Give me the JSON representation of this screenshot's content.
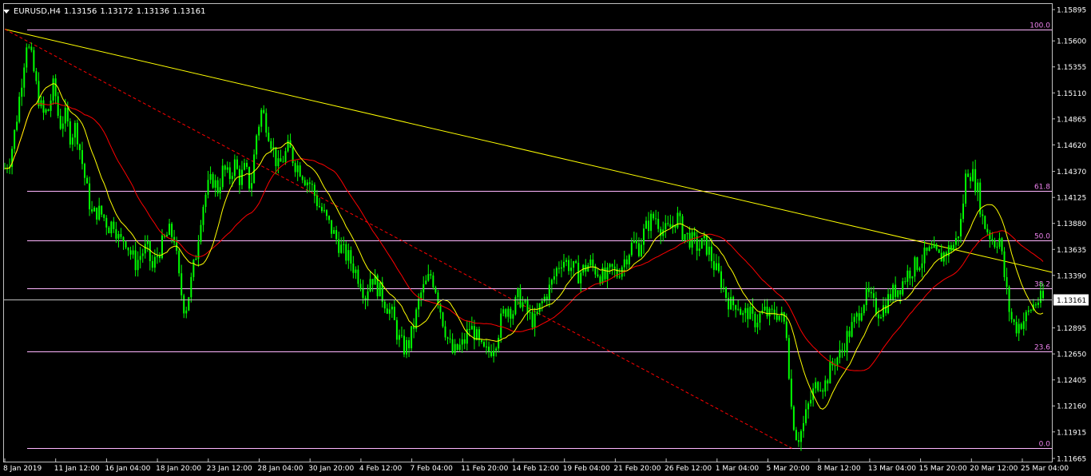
{
  "header": {
    "symbol": "EURUSD,H4",
    "open": "1.13156",
    "high": "1.13172",
    "low": "1.13136",
    "close": "1.13161"
  },
  "colors": {
    "background": "#000000",
    "candle": "#00ff00",
    "price_line": "#c0c0c0",
    "ma_fast": "#ffff00",
    "ma_slow": "#ff0000",
    "trendline": "#ffff00",
    "diagonal": "#ff0000",
    "fib": "#ffb6ff",
    "fib_label": "#ee82ee"
  },
  "chart_data": {
    "type": "candlestick",
    "ylim": [
      1.11665,
      1.15895
    ],
    "y_ticks": [
      "1.15895",
      "1.15600",
      "1.15355",
      "1.15110",
      "1.14865",
      "1.14620",
      "1.14370",
      "1.14125",
      "1.13880",
      "1.13635",
      "1.13390",
      "1.12895",
      "1.12650",
      "1.12405",
      "1.12160",
      "1.11915",
      "1.11665"
    ],
    "x_ticks": [
      "8 Jan 2019",
      "11 Jan 12:00",
      "16 Jan 04:00",
      "18 Jan 20:00",
      "23 Jan 12:00",
      "28 Jan 04:00",
      "30 Jan 20:00",
      "4 Feb 12:00",
      "7 Feb 04:00",
      "11 Feb 20:00",
      "14 Feb 12:00",
      "19 Feb 04:00",
      "21 Feb 20:00",
      "26 Feb 12:00",
      "1 Mar 04:00",
      "5 Mar 20:00",
      "8 Mar 12:00",
      "13 Mar 04:00",
      "15 Mar 20:00",
      "20 Mar 12:00",
      "25 Mar 04:00"
    ],
    "current_price": "1.13161",
    "fib_levels": [
      {
        "label": "100.0",
        "price": 1.1571
      },
      {
        "label": "61.8",
        "price": 1.1419
      },
      {
        "label": "50.0",
        "price": 1.1372
      },
      {
        "label": "38.2",
        "price": 1.1327
      },
      {
        "label": "23.6",
        "price": 1.1267
      },
      {
        "label": "0.0",
        "price": 1.1176
      }
    ],
    "trendline": {
      "from": {
        "x": "8 Jan 2019",
        "price": 1.1571
      },
      "to": {
        "x": "25 Mar 04:00",
        "price": 1.1342
      }
    },
    "diagonal": {
      "from": {
        "x": "8 Jan 2019",
        "price": 1.1571
      },
      "to": {
        "x": "5 Mar 20:00",
        "price": 1.1176
      }
    },
    "close_path": [
      [
        0,
        1.144
      ],
      [
        0.5,
        1.145
      ],
      [
        1,
        1.148
      ],
      [
        1.5,
        1.152
      ],
      [
        2,
        1.156
      ],
      [
        2.5,
        1.154
      ],
      [
        3,
        1.151
      ],
      [
        3.5,
        1.149
      ],
      [
        4,
        1.1495
      ],
      [
        4.5,
        1.152
      ],
      [
        5,
        1.148
      ],
      [
        5.5,
        1.149
      ],
      [
        6,
        1.147
      ],
      [
        6.5,
        1.148
      ],
      [
        7,
        1.145
      ],
      [
        7.5,
        1.142
      ],
      [
        8,
        1.1395
      ],
      [
        8.5,
        1.14
      ],
      [
        9,
        1.1395
      ],
      [
        9.5,
        1.1385
      ],
      [
        10,
        1.139
      ],
      [
        10.5,
        1.137
      ],
      [
        11,
        1.1375
      ],
      [
        11.5,
        1.136
      ],
      [
        12,
        1.135
      ],
      [
        12.5,
        1.136
      ],
      [
        13,
        1.1365
      ],
      [
        13.5,
        1.1345
      ],
      [
        14,
        1.136
      ],
      [
        14.5,
        1.137
      ],
      [
        15,
        1.138
      ],
      [
        15.5,
        1.1375
      ],
      [
        16,
        1.133
      ],
      [
        16.5,
        1.1305
      ],
      [
        17,
        1.133
      ],
      [
        17.5,
        1.136
      ],
      [
        18,
        1.14
      ],
      [
        18.5,
        1.142
      ],
      [
        19,
        1.143
      ],
      [
        19.5,
        1.142
      ],
      [
        20,
        1.144
      ],
      [
        20.5,
        1.143
      ],
      [
        21,
        1.1445
      ],
      [
        21.5,
        1.143
      ],
      [
        22,
        1.144
      ],
      [
        22.5,
        1.142
      ],
      [
        23,
        1.147
      ],
      [
        23.5,
        1.1495
      ],
      [
        24,
        1.148
      ],
      [
        24.5,
        1.146
      ],
      [
        25,
        1.144
      ],
      [
        25.5,
        1.145
      ],
      [
        26,
        1.146
      ],
      [
        26.5,
        1.1445
      ],
      [
        27,
        1.144
      ],
      [
        27.5,
        1.143
      ],
      [
        28,
        1.1425
      ],
      [
        28.5,
        1.141
      ],
      [
        29,
        1.14
      ],
      [
        29.5,
        1.139
      ],
      [
        30,
        1.138
      ],
      [
        30.5,
        1.137
      ],
      [
        31,
        1.136
      ],
      [
        31.5,
        1.1355
      ],
      [
        32,
        1.1345
      ],
      [
        32.5,
        1.1335
      ],
      [
        33,
        1.132
      ],
      [
        33.5,
        1.134
      ],
      [
        34,
        1.133
      ],
      [
        34.5,
        1.132
      ],
      [
        35,
        1.131
      ],
      [
        35.5,
        1.13
      ],
      [
        36,
        1.128
      ],
      [
        36.5,
        1.127
      ],
      [
        37,
        1.1275
      ],
      [
        37.5,
        1.1295
      ],
      [
        38,
        1.132
      ],
      [
        38.5,
        1.133
      ],
      [
        39,
        1.134
      ],
      [
        39.5,
        1.1325
      ],
      [
        40,
        1.13
      ],
      [
        40.5,
        1.128
      ],
      [
        41,
        1.1265
      ],
      [
        41.5,
        1.127
      ],
      [
        42,
        1.1275
      ],
      [
        42.5,
        1.129
      ],
      [
        43,
        1.1285
      ],
      [
        43.5,
        1.127
      ],
      [
        44,
        1.1265
      ],
      [
        44.5,
        1.127
      ],
      [
        45,
        1.128
      ],
      [
        45.5,
        1.13
      ],
      [
        46,
        1.131
      ],
      [
        46.5,
        1.1305
      ],
      [
        47,
        1.132
      ],
      [
        47.5,
        1.131
      ],
      [
        48,
        1.13
      ],
      [
        48.5,
        1.1295
      ],
      [
        49,
        1.131
      ],
      [
        49.5,
        1.132
      ],
      [
        50,
        1.133
      ],
      [
        50.5,
        1.1345
      ],
      [
        51,
        1.1355
      ],
      [
        51.5,
        1.135
      ],
      [
        52,
        1.1345
      ],
      [
        52.5,
        1.134
      ],
      [
        53,
        1.1345
      ],
      [
        53.5,
        1.135
      ],
      [
        54,
        1.1345
      ],
      [
        54.5,
        1.134
      ],
      [
        55,
        1.1335
      ],
      [
        55.5,
        1.1345
      ],
      [
        56,
        1.134
      ],
      [
        56.5,
        1.135
      ],
      [
        57,
        1.136
      ],
      [
        57.5,
        1.137
      ],
      [
        58,
        1.1365
      ],
      [
        58.5,
        1.138
      ],
      [
        59,
        1.139
      ],
      [
        59.5,
        1.1395
      ],
      [
        60,
        1.1385
      ],
      [
        60.5,
        1.138
      ],
      [
        61,
        1.1385
      ],
      [
        61.5,
        1.1395
      ],
      [
        62,
        1.138
      ],
      [
        62.5,
        1.1375
      ],
      [
        63,
        1.137
      ],
      [
        63.5,
        1.1365
      ],
      [
        64,
        1.137
      ],
      [
        64.5,
        1.136
      ],
      [
        65,
        1.1345
      ],
      [
        65.5,
        1.1335
      ],
      [
        66,
        1.132
      ],
      [
        66.5,
        1.131
      ],
      [
        67,
        1.1315
      ],
      [
        67.5,
        1.13
      ],
      [
        68,
        1.1305
      ],
      [
        68.5,
        1.1295
      ],
      [
        69,
        1.13
      ],
      [
        69.5,
        1.1305
      ],
      [
        70,
        1.13
      ],
      [
        70.5,
        1.1305
      ],
      [
        71,
        1.13
      ],
      [
        71.5,
        1.129
      ],
      [
        72,
        1.121
      ],
      [
        72.5,
        1.1185
      ],
      [
        73,
        1.1195
      ],
      [
        73.5,
        1.1215
      ],
      [
        74,
        1.123
      ],
      [
        74.5,
        1.124
      ],
      [
        75,
        1.1235
      ],
      [
        75.5,
        1.125
      ],
      [
        76,
        1.126
      ],
      [
        76.5,
        1.1265
      ],
      [
        77,
        1.128
      ],
      [
        77.5,
        1.129
      ],
      [
        78,
        1.13
      ],
      [
        78.5,
        1.1315
      ],
      [
        79,
        1.132
      ],
      [
        79.5,
        1.131
      ],
      [
        80,
        1.1305
      ],
      [
        80.5,
        1.131
      ],
      [
        81,
        1.132
      ],
      [
        81.5,
        1.1325
      ],
      [
        82,
        1.133
      ],
      [
        82.5,
        1.134
      ],
      [
        83,
        1.1345
      ],
      [
        83.5,
        1.135
      ],
      [
        84,
        1.1355
      ],
      [
        84.5,
        1.136
      ],
      [
        85,
        1.136
      ],
      [
        85.5,
        1.1355
      ],
      [
        86,
        1.136
      ],
      [
        86.5,
        1.1365
      ],
      [
        87,
        1.137
      ],
      [
        87.5,
        1.139
      ],
      [
        88,
        1.144
      ],
      [
        88.5,
        1.1435
      ],
      [
        89,
        1.142
      ],
      [
        89.5,
        1.139
      ],
      [
        90,
        1.138
      ],
      [
        90.5,
        1.137
      ],
      [
        91,
        1.1375
      ],
      [
        91.5,
        1.1335
      ],
      [
        92,
        1.13
      ],
      [
        92.5,
        1.129
      ],
      [
        93,
        1.1295
      ],
      [
        93.5,
        1.13
      ],
      [
        94,
        1.131
      ],
      [
        94.5,
        1.1315
      ],
      [
        95,
        1.1316
      ]
    ]
  }
}
